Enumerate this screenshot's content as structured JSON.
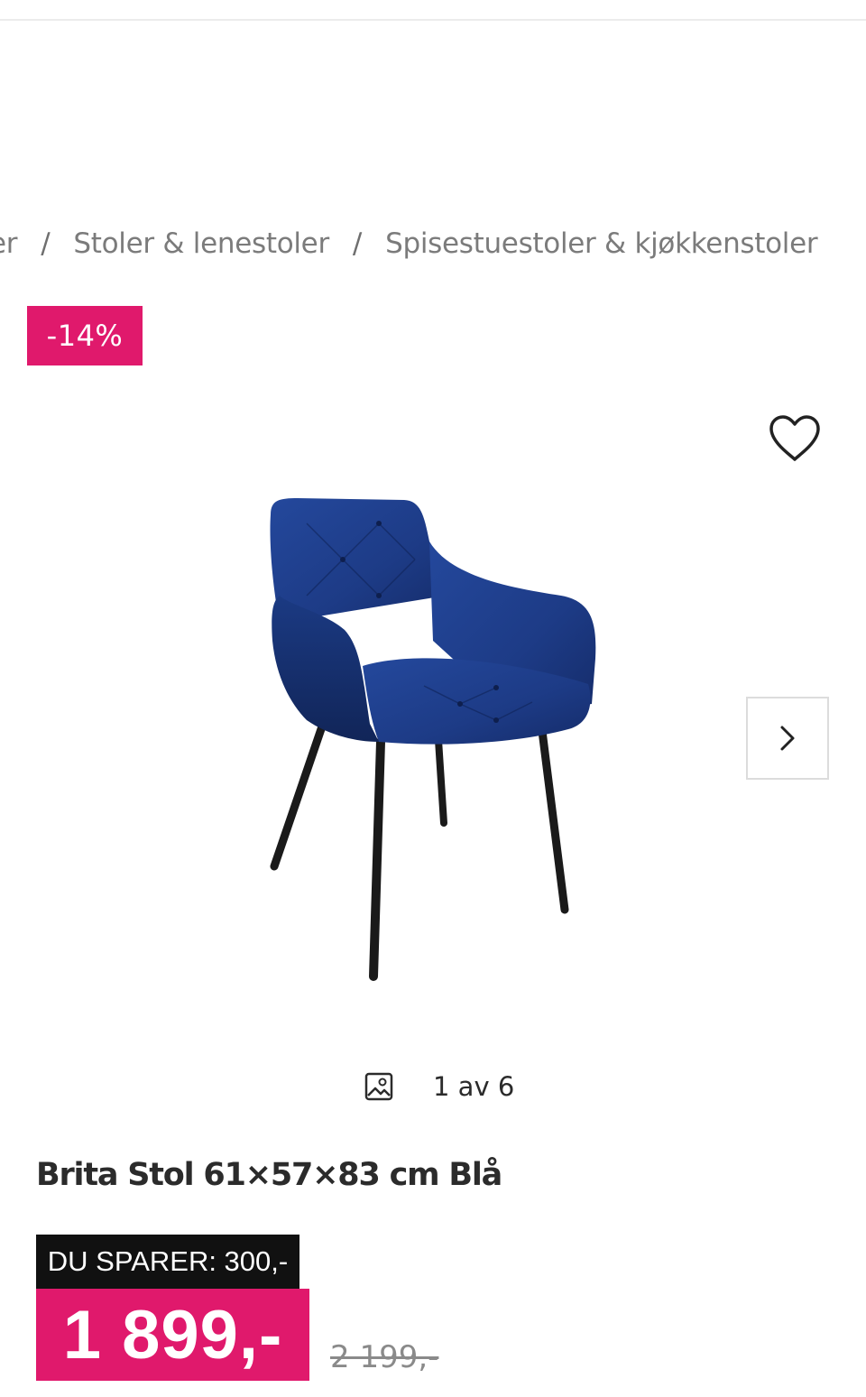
{
  "breadcrumb": {
    "items": [
      "er",
      "Stoler & lenestoler",
      "Spisestuestoler & kjøkkenstoler"
    ],
    "separator": "/"
  },
  "product": {
    "discount_badge": "-14%",
    "title": "Brita Stol 61×57×83 cm Blå",
    "image_counter": "1 av 6",
    "savings": "DU SPARER: 300,-",
    "price": "1 899,-",
    "old_price": "2 199,-"
  },
  "icons": {
    "favorite": "heart-outline-icon",
    "next": "chevron-right-icon",
    "gallery": "image-icon"
  },
  "colors": {
    "accent": "#e0196c",
    "savings_bg": "#111111",
    "chair_fabric": "#1f3f8f"
  }
}
